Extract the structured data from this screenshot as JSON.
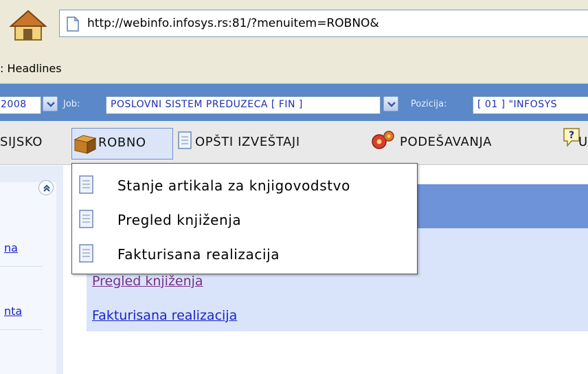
{
  "browser": {
    "url": "http://webinfo.infosys.rs:81/?menuitem=ROBNO&",
    "bookmark": ": Headlines"
  },
  "job_strip": {
    "year_value": "2008",
    "job_label": "Job:",
    "job_value": "POSLOVNI SISTEM PREDUZECA [ FIN ]",
    "position_label": "Pozicija:",
    "position_value": "[ 01 ] \"INFOSYS"
  },
  "menu": {
    "items": [
      {
        "label": "SIJSKO",
        "icon": "none"
      },
      {
        "label": "ROBNO",
        "icon": "box-icon"
      },
      {
        "label": "OPŠTI IZVEŠTAJI",
        "icon": "document-icon"
      },
      {
        "label": "PODEŠAVANJA",
        "icon": "gears-icon"
      },
      {
        "label": "UP",
        "icon": "help-icon"
      }
    ]
  },
  "dropdown": {
    "items": [
      {
        "label": "Stanje artikala za knjigovodstvo"
      },
      {
        "label": "Pregled knjiženja"
      },
      {
        "label": "Fakturisana realizacija"
      }
    ]
  },
  "left_panel": {
    "links": [
      {
        "label": "na"
      },
      {
        "label": "nta"
      }
    ]
  },
  "content": {
    "links": [
      {
        "label": "Pregled knjiženja"
      },
      {
        "label": "Fakturisana realizacija"
      }
    ]
  },
  "colors": {
    "strip": "#5a88c8",
    "content_header": "#6f93d8",
    "content_body": "#d9e4fb",
    "link": "#1a22c8",
    "visited": "#7a2d8a"
  }
}
